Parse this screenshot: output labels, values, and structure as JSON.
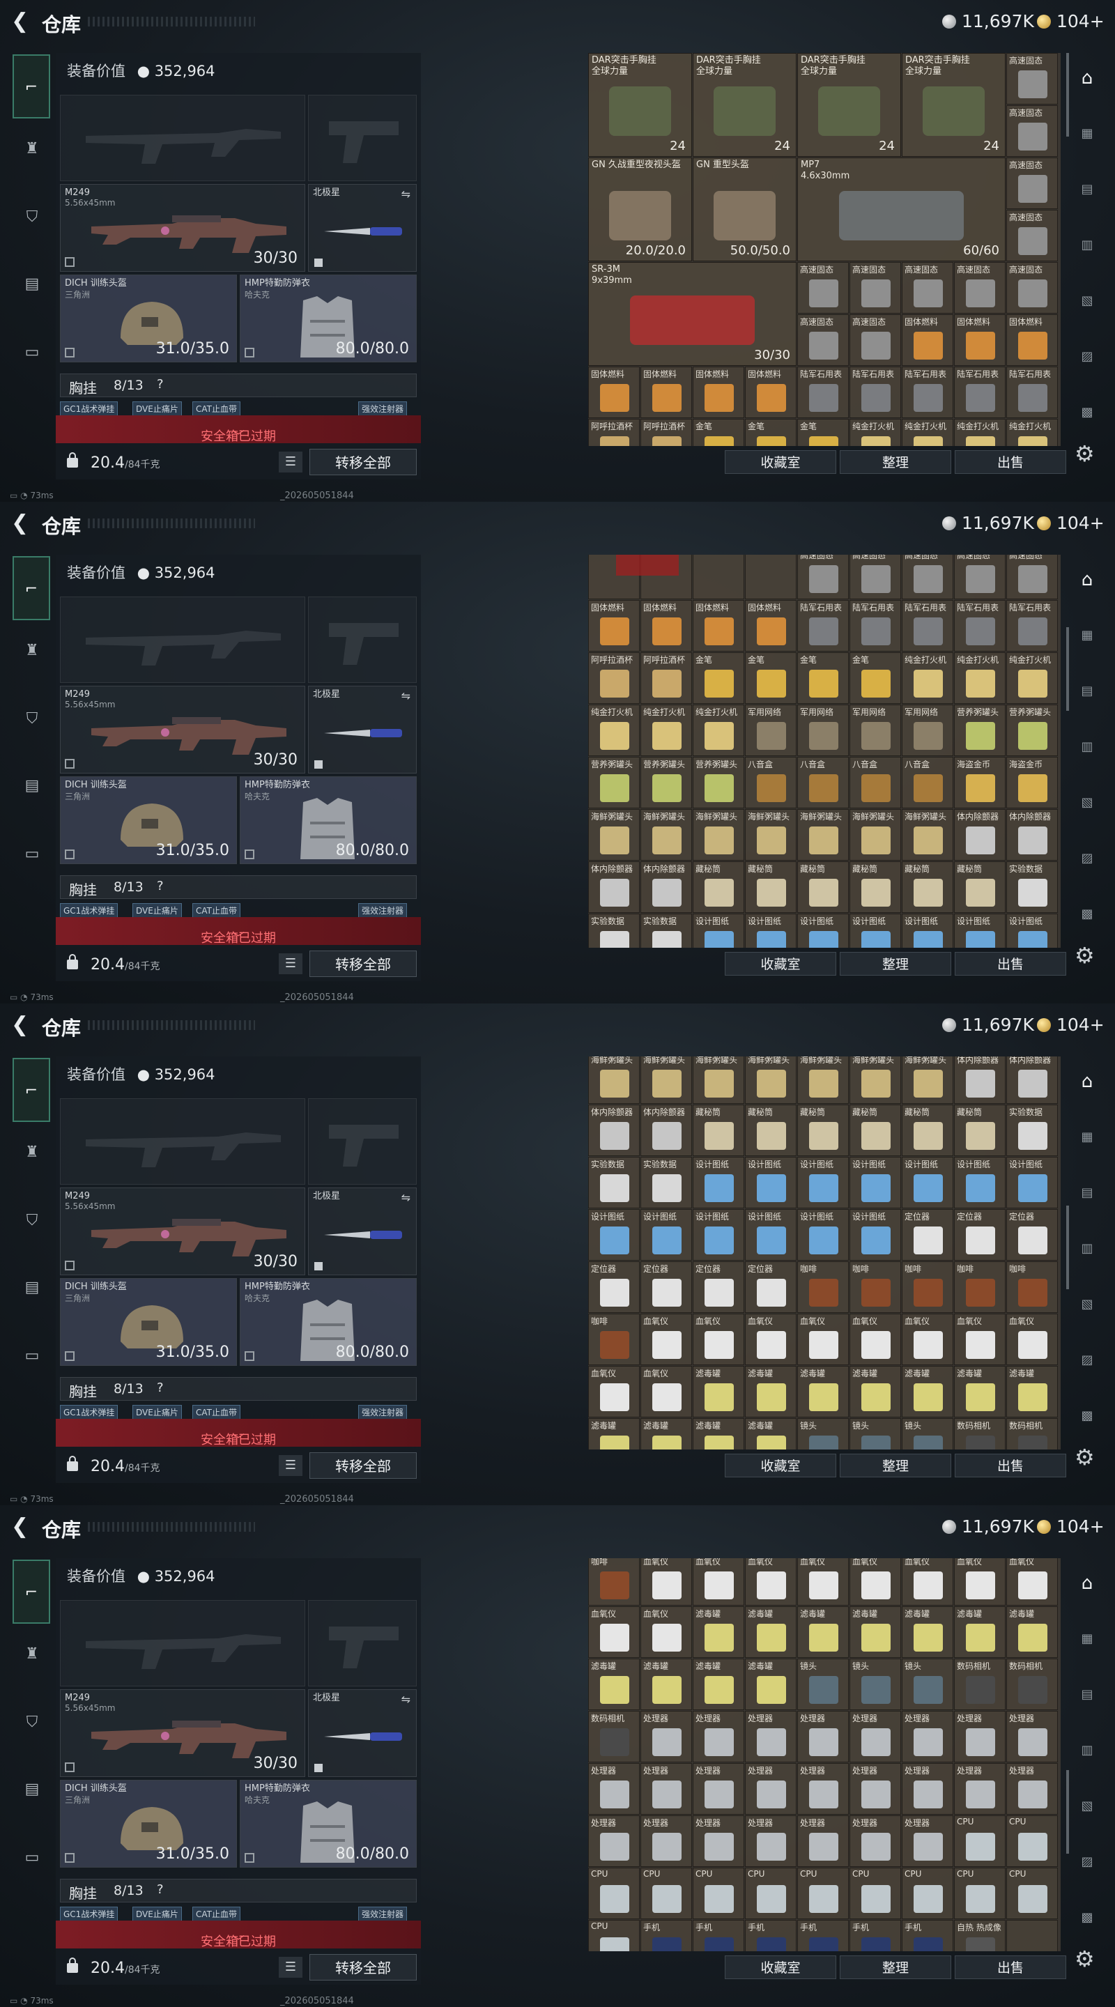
{
  "header": {
    "title": "仓库",
    "currency_silver": "11,697K",
    "currency_gold": "104+"
  },
  "loadout": {
    "value_label": "装备价值",
    "value": "352,964",
    "primary": {
      "name": "M249",
      "caliber": "5.56x45mm",
      "ammo": "30/30"
    },
    "melee": {
      "name": "北极星"
    },
    "helmet": {
      "name": "DICH 训练头盔",
      "sub": "三角洲",
      "durability": "31.0/35.0"
    },
    "armor": {
      "name": "HMP特勤防弹衣",
      "sub": "哈夫克",
      "durability": "80.0/80.0"
    },
    "vest_label": "胸挂",
    "vest_count": "8/13",
    "vest_help": "?",
    "chips": [
      "GC1战术弹挂",
      "DVE止痛片",
      "CAT止血带",
      "强效注射器"
    ],
    "safe_box_expired": "安全箱已过期",
    "weight": "20.4",
    "weight_unit": "/84千克",
    "transfer_all": "转移全部"
  },
  "buttons": {
    "collection": "收藏室",
    "organize": "整理",
    "sell": "出售"
  },
  "status": {
    "ping": "73ms",
    "build": "_202605051844"
  },
  "frames": [
    {
      "big": [
        {
          "l1": "DAR突击手胸挂",
          "l2": "全球力量",
          "cnt": "24"
        },
        {
          "l1": "DAR突击手胸挂",
          "l2": "全球力量",
          "cnt": "24"
        },
        {
          "l1": "DAR突击手胸挂",
          "l2": "全球力量",
          "cnt": "24"
        },
        {
          "l1": "DAR突击手胸挂",
          "l2": "全球力量",
          "cnt": "24"
        },
        {
          "l1": "GN 久战重型夜视头盔",
          "l2": "",
          "cnt": "20.0/20.0"
        },
        {
          "l1": "GN 重型头盔",
          "l2": "",
          "cnt": "50.0/50.0"
        },
        {
          "l1": "MP7",
          "l2": "4.6x30mm",
          "cnt": "60/60"
        },
        {
          "l1": "SR-3M",
          "l2": "9x39mm",
          "cnt": "30/30"
        }
      ],
      "rows": [
        [
          "高速固态",
          "高速固态",
          "高速固态",
          "高速固态",
          "高速固态"
        ],
        [
          "高速固态",
          "高速固态",
          "固体燃料",
          "固体燃料",
          "固体燃料"
        ],
        [
          "固体燃料",
          "固体燃料",
          "固体燃料",
          "固体燃料",
          "陆军石用表",
          "陆军石用表",
          "陆军石用表",
          "陆军石用表",
          "陆军石用表"
        ],
        [
          "阿呼拉酒杯",
          "阿呼拉酒杯",
          "金笔",
          "金笔",
          "金笔",
          "纯金打火机",
          "纯金打火机",
          "纯金打火机",
          "纯金打火机"
        ]
      ],
      "side": [
        "高速固态",
        "高速固态",
        "高速固态",
        "高速固态"
      ]
    },
    {
      "rows": [
        [
          "",
          "",
          "",
          "",
          "高速固态",
          "高速固态",
          "高速固态",
          "高速固态",
          "高速固态"
        ],
        [
          "固体燃料",
          "固体燃料",
          "固体燃料",
          "固体燃料",
          "陆军石用表",
          "陆军石用表",
          "陆军石用表",
          "陆军石用表",
          "陆军石用表"
        ],
        [
          "阿呼拉酒杯",
          "阿呼拉酒杯",
          "金笔",
          "金笔",
          "金笔",
          "金笔",
          "纯金打火机",
          "纯金打火机",
          "纯金打火机"
        ],
        [
          "纯金打火机",
          "纯金打火机",
          "纯金打火机",
          "军用网络",
          "军用网络",
          "军用网络",
          "军用网络",
          "营养粥罐头",
          "营养粥罐头"
        ],
        [
          "营养粥罐头",
          "营养粥罐头",
          "营养粥罐头",
          "八音盒",
          "八音盒",
          "八音盒",
          "八音盒",
          "海盗金币",
          "海盗金币"
        ],
        [
          "海鲜粥罐头",
          "海鲜粥罐头",
          "海鲜粥罐头",
          "海鲜粥罐头",
          "海鲜粥罐头",
          "海鲜粥罐头",
          "海鲜粥罐头",
          "体内除颤器",
          "体内除颤器"
        ],
        [
          "体内除颤器",
          "体内除颤器",
          "藏秘筒",
          "藏秘筒",
          "藏秘筒",
          "藏秘筒",
          "藏秘筒",
          "藏秘筒",
          "实验数据"
        ],
        [
          "实验数据",
          "实验数据",
          "设计图纸",
          "设计图纸",
          "设计图纸",
          "设计图纸",
          "设计图纸",
          "设计图纸",
          "设计图纸"
        ]
      ]
    },
    {
      "rows": [
        [
          "海鲜粥罐头",
          "海鲜粥罐头",
          "海鲜粥罐头",
          "海鲜粥罐头",
          "海鲜粥罐头",
          "海鲜粥罐头",
          "海鲜粥罐头",
          "体内除颤器",
          "体内除颤器"
        ],
        [
          "体内除颤器",
          "体内除颤器",
          "藏秘筒",
          "藏秘筒",
          "藏秘筒",
          "藏秘筒",
          "藏秘筒",
          "藏秘筒",
          "实验数据"
        ],
        [
          "实验数据",
          "实验数据",
          "设计图纸",
          "设计图纸",
          "设计图纸",
          "设计图纸",
          "设计图纸",
          "设计图纸",
          "设计图纸"
        ],
        [
          "设计图纸",
          "设计图纸",
          "设计图纸",
          "设计图纸",
          "设计图纸",
          "设计图纸",
          "定位器",
          "定位器",
          "定位器"
        ],
        [
          "定位器",
          "定位器",
          "定位器",
          "定位器",
          "咖啡",
          "咖啡",
          "咖啡",
          "咖啡",
          "咖啡"
        ],
        [
          "咖啡",
          "血氧仪",
          "血氧仪",
          "血氧仪",
          "血氧仪",
          "血氧仪",
          "血氧仪",
          "血氧仪",
          "血氧仪"
        ],
        [
          "血氧仪",
          "血氧仪",
          "滤毒罐",
          "滤毒罐",
          "滤毒罐",
          "滤毒罐",
          "滤毒罐",
          "滤毒罐",
          "滤毒罐"
        ],
        [
          "滤毒罐",
          "滤毒罐",
          "滤毒罐",
          "滤毒罐",
          "镜头",
          "镜头",
          "镜头",
          "数码相机",
          "数码相机"
        ]
      ]
    },
    {
      "rows": [
        [
          "咖啡",
          "血氧仪",
          "血氧仪",
          "血氧仪",
          "血氧仪",
          "血氧仪",
          "血氧仪",
          "血氧仪",
          "血氧仪"
        ],
        [
          "血氧仪",
          "血氧仪",
          "滤毒罐",
          "滤毒罐",
          "滤毒罐",
          "滤毒罐",
          "滤毒罐",
          "滤毒罐",
          "滤毒罐"
        ],
        [
          "滤毒罐",
          "滤毒罐",
          "滤毒罐",
          "滤毒罐",
          "镜头",
          "镜头",
          "镜头",
          "数码相机",
          "数码相机"
        ],
        [
          "数码相机",
          "处理器",
          "处理器",
          "处理器",
          "处理器",
          "处理器",
          "处理器",
          "处理器",
          "处理器"
        ],
        [
          "处理器",
          "处理器",
          "处理器",
          "处理器",
          "处理器",
          "处理器",
          "处理器",
          "处理器",
          "处理器"
        ],
        [
          "处理器",
          "处理器",
          "处理器",
          "处理器",
          "处理器",
          "处理器",
          "处理器",
          "CPU",
          "CPU"
        ],
        [
          "CPU",
          "CPU",
          "CPU",
          "CPU",
          "CPU",
          "CPU",
          "CPU",
          "CPU",
          "CPU"
        ],
        [
          "CPU",
          "手机",
          "手机",
          "手机",
          "手机",
          "手机",
          "手机",
          "自热 热成像",
          ""
        ]
      ]
    }
  ],
  "item_colors": {
    "高速固态": "#8f8f8f",
    "固体燃料": "#d08a3a",
    "陆军石用表": "#7a7c80",
    "阿呼拉酒杯": "#c9a86a",
    "金笔": "#d8b045",
    "纯金打火机": "#d9c27a",
    "军用网络": "#8b7f68",
    "营养粥罐头": "#b8c26a",
    "八音盒": "#a67a3a",
    "海盗金币": "#d6b050",
    "海鲜粥罐头": "#c8b47c",
    "体内除颤器": "#c6c6c6",
    "藏秘筒": "#cfc4a4",
    "实验数据": "#d8d8d8",
    "设计图纸": "#6aa6d8",
    "定位器": "#e2e2e2",
    "咖啡": "#8a4a2a",
    "血氧仪": "#e6e6e6",
    "滤毒罐": "#d8d27a",
    "镜头": "#5a6e7a",
    "数码相机": "#4a4a4a",
    "处理器": "#b8bcc0",
    "CPU": "#bfc8cc",
    "手机": "#2a3a6a",
    "自热 热成像": "#555555"
  }
}
